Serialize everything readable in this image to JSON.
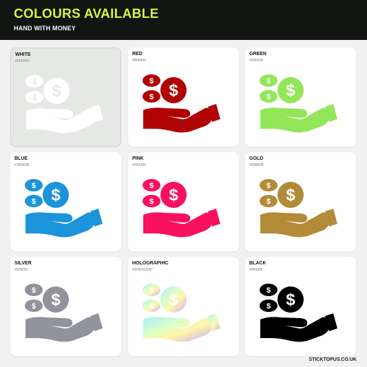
{
  "header": {
    "title": "COLOURS AVAILABLE",
    "subtitle": "HAND WITH MONEY"
  },
  "colours": [
    {
      "name": "WHITE",
      "code": "#FFFFFF",
      "color": "#ffffff"
    },
    {
      "name": "RED",
      "code": "#B00404",
      "color": "#b00404"
    },
    {
      "name": "GREEN",
      "code": "#93E658",
      "color": "#93e658"
    },
    {
      "name": "BLUE",
      "code": "#1B94DB",
      "color": "#1b94db"
    },
    {
      "name": "PINK",
      "code": "#FA1060",
      "color": "#fa1060"
    },
    {
      "name": "GOLD",
      "code": "#B38A38",
      "color": "#b38a38"
    },
    {
      "name": "SILVER",
      "code": "#92929C",
      "color": "#92929c"
    },
    {
      "name": "HOLOGRAPHIC",
      "code": "IRIDESCENT",
      "color": "holographic"
    },
    {
      "name": "BLACK",
      "code": "#000000",
      "color": "#000000"
    }
  ],
  "footer": {
    "site": "STICKTOPUS.CO.UK"
  },
  "icon": "hand-with-money-icon"
}
